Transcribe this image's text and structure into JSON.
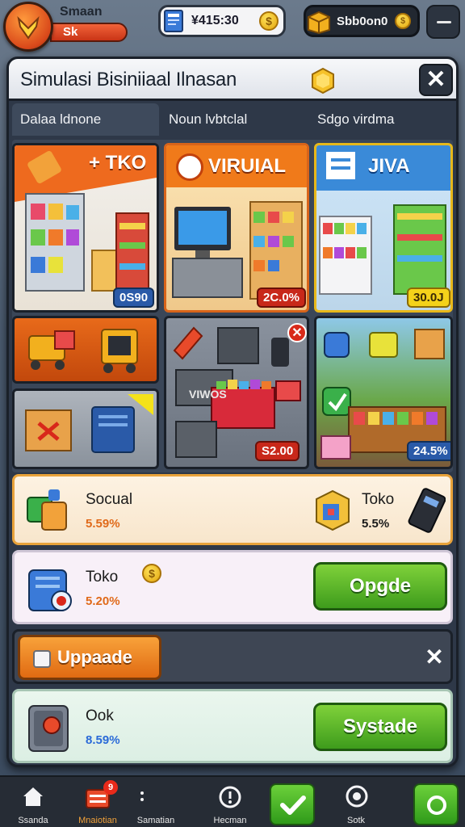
{
  "player": {
    "name": "Smaan",
    "level": "Sk"
  },
  "currency": {
    "money": "¥415:30",
    "gold": "Sbb0on0"
  },
  "panel": {
    "title": "Simulasi Bisiniiaal Ilnasan",
    "close": "✕",
    "tabs": [
      "Dalaa ldnone",
      "Noun lvbtclal",
      "Sdgo virdma"
    ]
  },
  "cards": [
    {
      "label": "+ TKO",
      "price": "0S90"
    },
    {
      "label": "VIRUIAL",
      "price": "2C.0%"
    },
    {
      "label": "JIVA",
      "price": "30.0J"
    },
    {
      "label": "",
      "price": ""
    },
    {
      "label": "",
      "price": ""
    },
    {
      "label": "VIWOS",
      "price": "S2.00"
    },
    {
      "label": "",
      "price": "24.5%"
    }
  ],
  "rows": [
    {
      "name": "Socual",
      "pct": "5.59%",
      "right_name": "Toko",
      "right_pct": "5.5%"
    },
    {
      "name": "Toko",
      "pct": "5.20%",
      "button": "Opgde"
    },
    {
      "upgrade_label": "Uppaade",
      "close": "✕"
    },
    {
      "name": "Ook",
      "pct": "8.59%",
      "button": "Systade"
    }
  ],
  "nav": [
    {
      "label": "Ssanda",
      "icon": "home-icon"
    },
    {
      "label": "Mnaiotian",
      "icon": "shop-icon",
      "badge": "9"
    },
    {
      "label": "Samatian",
      "icon": "dots-icon"
    },
    {
      "label": "Hecman",
      "icon": "alert-icon"
    },
    {
      "label": "",
      "icon": "check-icon"
    },
    {
      "label": "Sotk",
      "icon": "power-icon"
    },
    {
      "label": "",
      "icon": "circle-icon"
    }
  ],
  "colors": {
    "accent_green": "#4aa822",
    "accent_orange": "#f07a1a",
    "panel": "#2e3848"
  }
}
